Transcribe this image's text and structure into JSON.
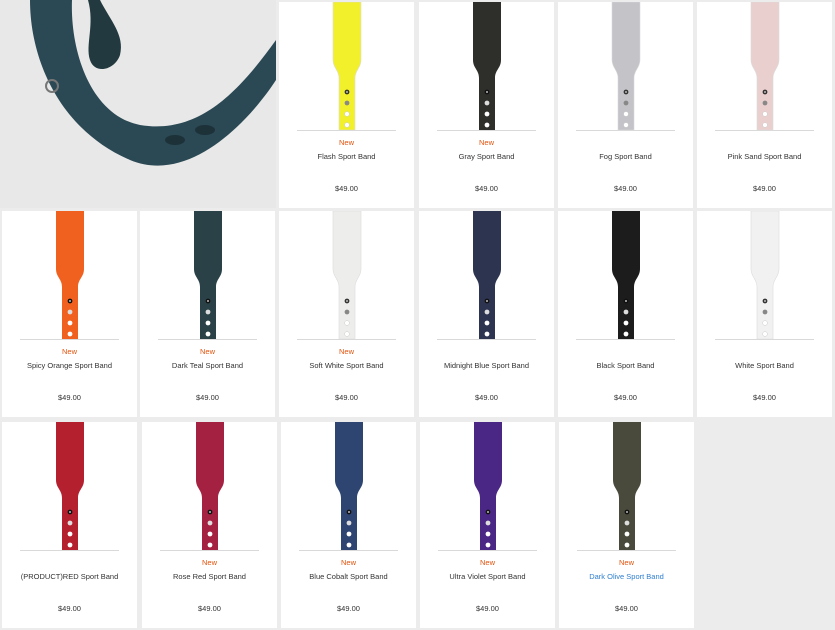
{
  "products": [
    {
      "name": "Flash Sport Band",
      "badge": "New",
      "price": "$49.00",
      "color": "#f2f02a"
    },
    {
      "name": "Gray Sport Band",
      "badge": "New",
      "price": "$49.00",
      "color": "#2e2f2b"
    },
    {
      "name": "Fog Sport Band",
      "badge": "",
      "price": "$49.00",
      "color": "#c3c3c8"
    },
    {
      "name": "Pink Sand Sport Band",
      "badge": "",
      "price": "$49.00",
      "color": "#e9cfcd"
    },
    {
      "name": "Spicy Orange Sport Band",
      "badge": "New",
      "price": "$49.00",
      "color": "#f0611f"
    },
    {
      "name": "Dark Teal Sport Band",
      "badge": "New",
      "price": "$49.00",
      "color": "#2a4147"
    },
    {
      "name": "Soft White Sport Band",
      "badge": "New",
      "price": "$49.00",
      "color": "#ededeb"
    },
    {
      "name": "Midnight Blue Sport Band",
      "badge": "",
      "price": "$49.00",
      "color": "#2d3450"
    },
    {
      "name": "Black Sport Band",
      "badge": "",
      "price": "$49.00",
      "color": "#1c1c1c"
    },
    {
      "name": "White Sport Band",
      "badge": "",
      "price": "$49.00",
      "color": "#f1f1f1"
    },
    {
      "name": "(PRODUCT)RED Sport Band",
      "badge": "",
      "price": "$49.00",
      "color": "#b5202f"
    },
    {
      "name": "Rose Red Sport Band",
      "badge": "New",
      "price": "$49.00",
      "color": "#a52141"
    },
    {
      "name": "Blue Cobalt Sport Band",
      "badge": "New",
      "price": "$49.00",
      "color": "#2d4570"
    },
    {
      "name": "Ultra Violet Sport Band",
      "badge": "New",
      "price": "$49.00",
      "color": "#4b2785"
    },
    {
      "name": "Dark Olive Sport Band",
      "badge": "New",
      "price": "$49.00",
      "color": "#4a4a3c",
      "linked": true
    }
  ],
  "hero": {
    "color": "#2b4954"
  }
}
